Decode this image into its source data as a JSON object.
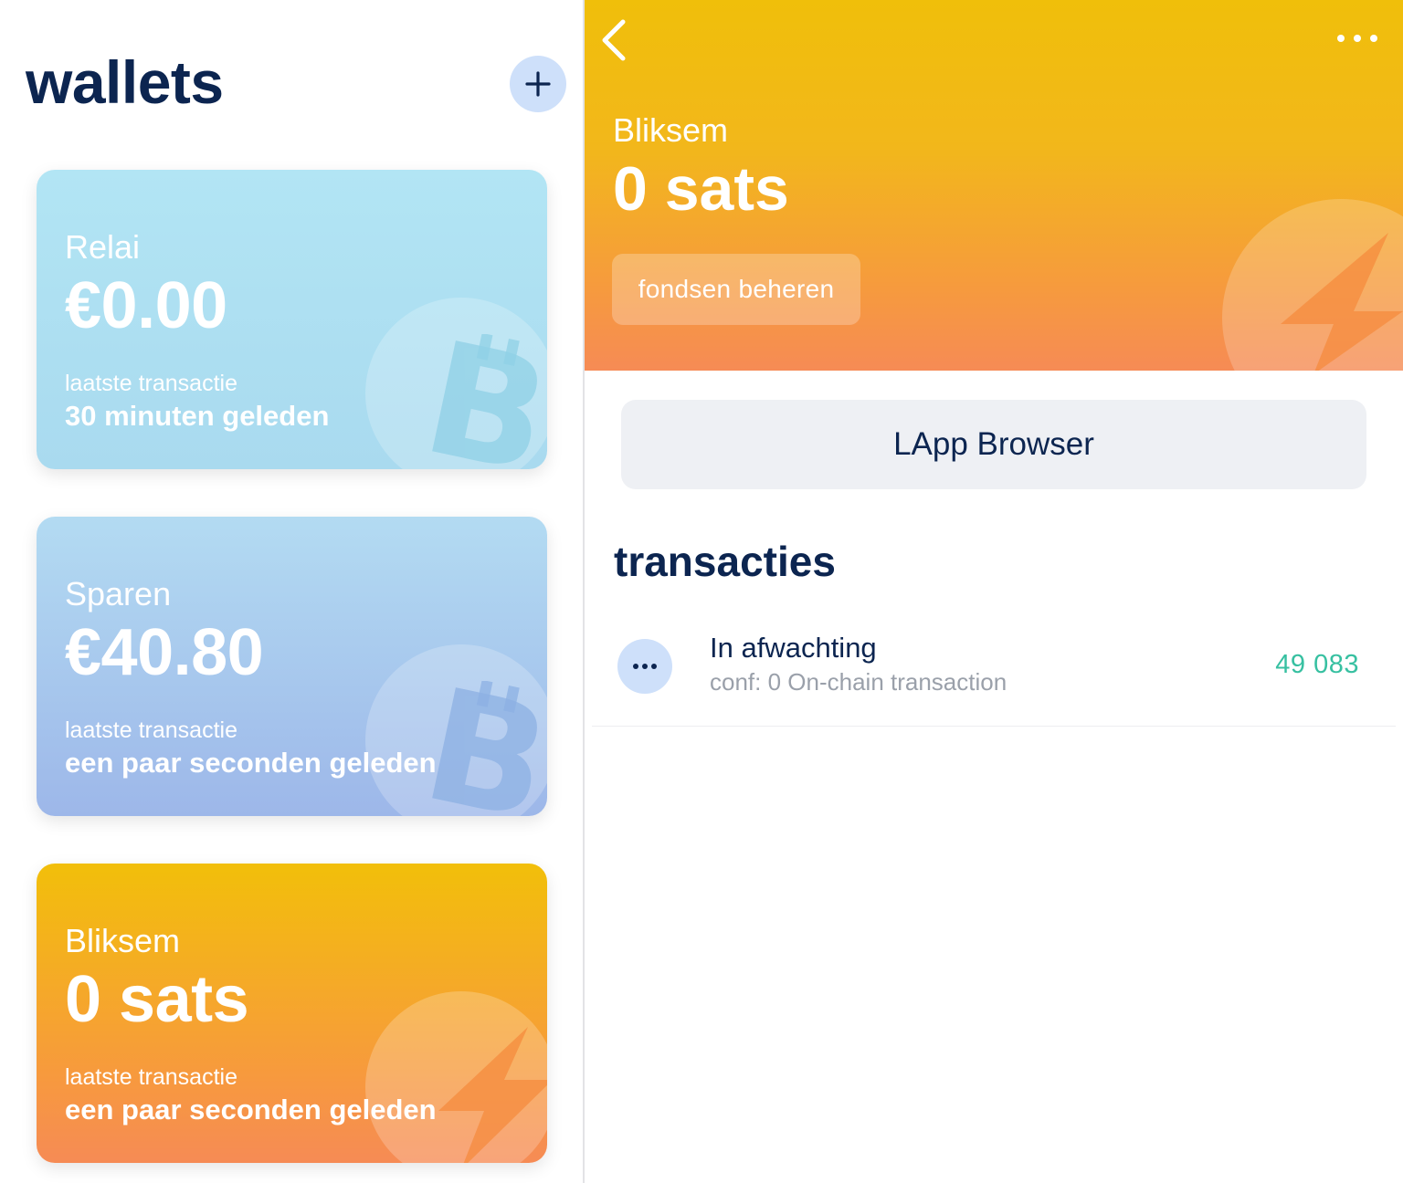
{
  "left": {
    "title": "wallets",
    "add_icon": "plus-icon",
    "wallets": [
      {
        "name": "Relai",
        "balance": "€0.00",
        "sublabel": "laatste transactie",
        "time": "30 minuten geleden",
        "icon": "bitcoin-icon"
      },
      {
        "name": "Sparen",
        "balance": "€40.80",
        "sublabel": "laatste transactie",
        "time": "een paar seconden geleden",
        "icon": "bitcoin-icon"
      },
      {
        "name": "Bliksem",
        "balance": "0 sats",
        "sublabel": "laatste transactie",
        "time": "een paar seconden geleden",
        "icon": "lightning-icon"
      }
    ]
  },
  "right": {
    "header": {
      "name": "Bliksem",
      "balance": "0 sats",
      "manage_label": "fondsen beheren",
      "back_icon": "chevron-left-icon",
      "more_icon": "more-dots-icon",
      "decor_icon": "lightning-icon"
    },
    "lapp_label": "LApp Browser",
    "transactions_title": "transacties",
    "transactions": [
      {
        "title": "In afwachting",
        "subtitle": "conf: 0 On-chain transaction",
        "amount": "49 083",
        "icon": "pending-dots-icon"
      }
    ]
  },
  "colors": {
    "navy": "#0c2550",
    "add_button_bg": "#cee0fa",
    "amount_green": "#37c0a1",
    "relai_card": "#b2e5f4",
    "sparen_card_top": "#b3dbf2",
    "sparen_card_bottom": "#9db7e9",
    "bliksem_top": "#f2bf0a",
    "bliksem_bottom": "#f68b55",
    "lapp_bg": "#eef0f4"
  }
}
